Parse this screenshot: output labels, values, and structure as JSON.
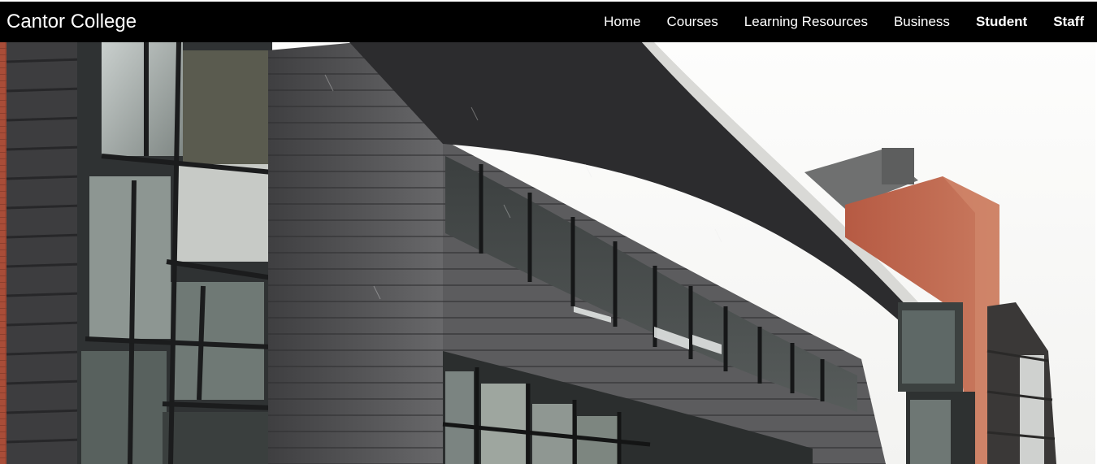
{
  "header": {
    "brand": "Cantor College",
    "nav": [
      {
        "label": "Home",
        "bold": false
      },
      {
        "label": "Courses",
        "bold": false
      },
      {
        "label": "Learning Resources",
        "bold": false
      },
      {
        "label": "Business",
        "bold": false
      },
      {
        "label": "Student",
        "bold": true
      },
      {
        "label": "Staff",
        "bold": true
      }
    ]
  },
  "hero": {
    "image_subject": "college-building-photo"
  },
  "colors": {
    "nav_background": "#000000",
    "nav_text": "#ffffff",
    "sky": "#fbfbfa",
    "cladding": "#4a4a4c",
    "brick": "#b5573f"
  }
}
